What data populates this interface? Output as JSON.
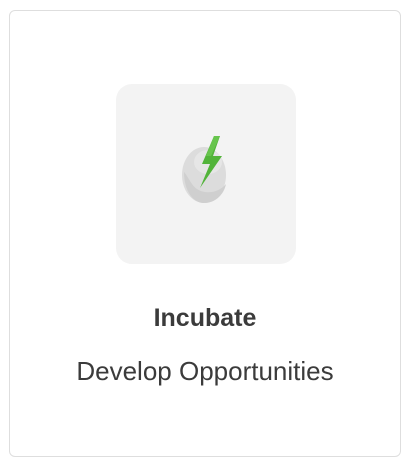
{
  "card": {
    "icon": "egg-lightning-icon",
    "title": "Incubate",
    "subtitle": "Develop Opportunities"
  },
  "colors": {
    "tile_background": "#f3f3f3",
    "egg_light": "#dcdcdc",
    "egg_shade": "#cfcfcf",
    "bolt_green": "#52b43a",
    "text": "#3b3b3b",
    "card_border": "#dedede"
  }
}
